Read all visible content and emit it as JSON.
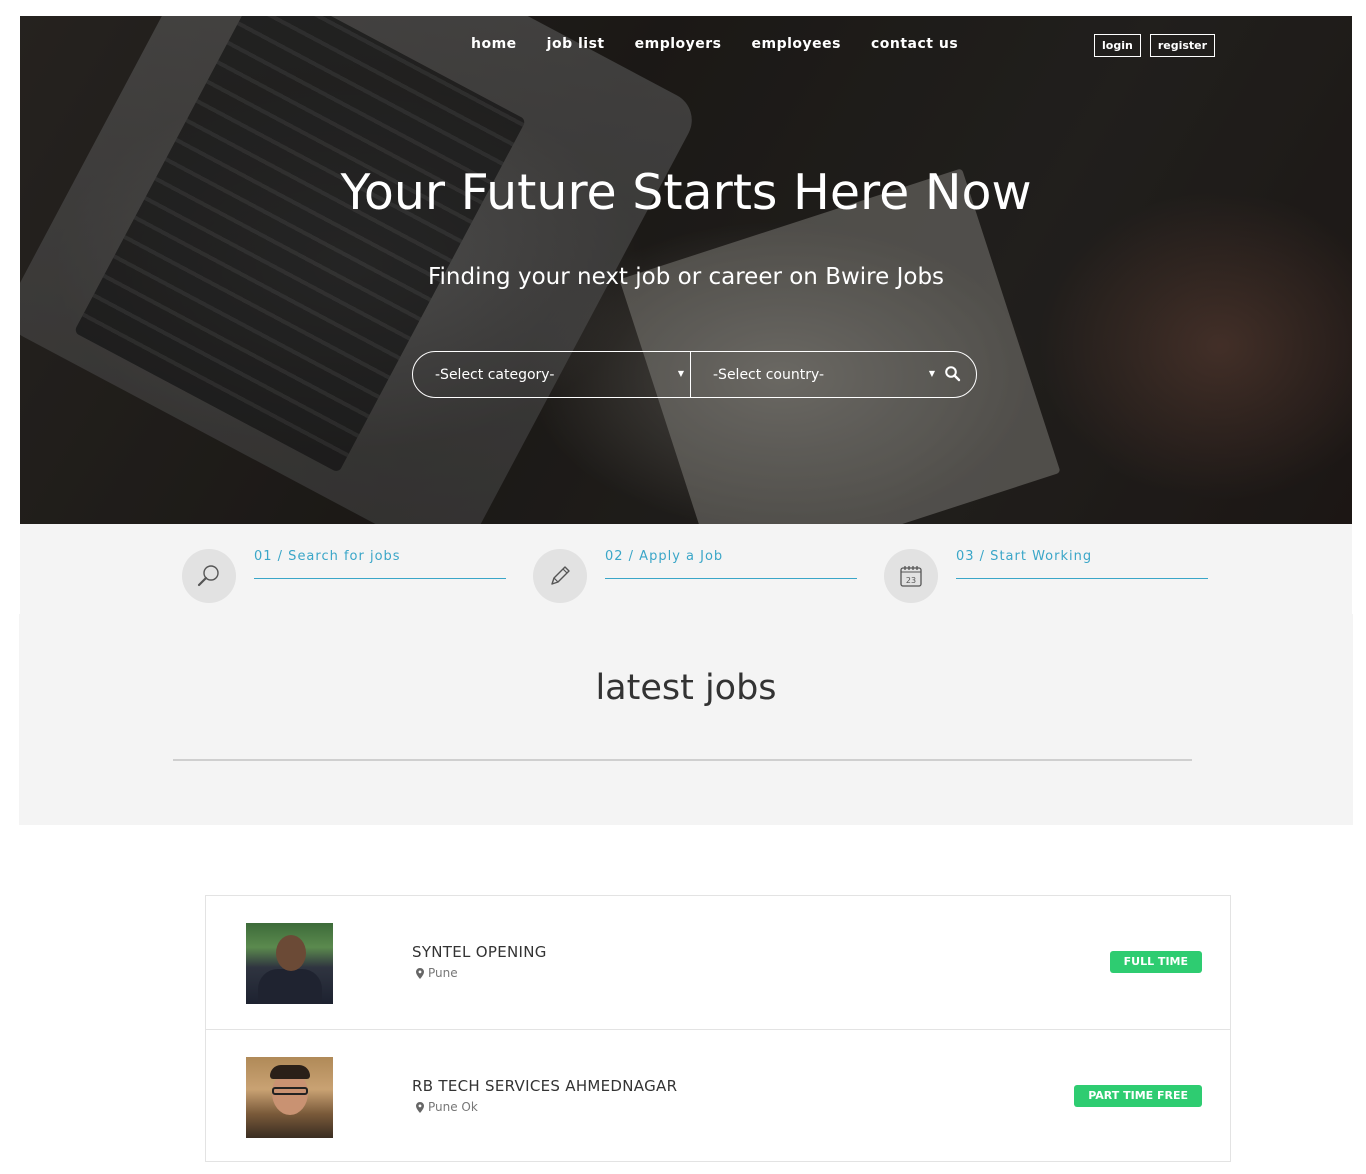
{
  "nav": {
    "links": [
      "home",
      "job list",
      "employers",
      "employees",
      "contact us"
    ],
    "login": "login",
    "register": "register"
  },
  "hero": {
    "title": "Your Future Starts Here Now",
    "subtitle": "Finding your next job or career on Bwire Jobs",
    "category_select": "-Select category-",
    "country_select": "-Select country-"
  },
  "steps": [
    {
      "label": "01 / Search for jobs",
      "icon": "magnifier-icon"
    },
    {
      "label": "02 / Apply a Job",
      "icon": "pencil-icon"
    },
    {
      "label": "03 / Start Working",
      "icon": "calendar-icon",
      "calendar_day": "23"
    }
  ],
  "latest": {
    "title": "latest jobs"
  },
  "jobs": [
    {
      "title": "SYNTEL OPENING",
      "location": "Pune",
      "badge": "FULL TIME"
    },
    {
      "title": "RB TECH SERVICES AHMEDNAGAR",
      "location": "Pune Ok",
      "badge": "PART TIME FREE"
    }
  ],
  "colors": {
    "accent": "#3aa6c8",
    "badge": "#2ecc71",
    "section_bg": "#f4f4f4"
  }
}
